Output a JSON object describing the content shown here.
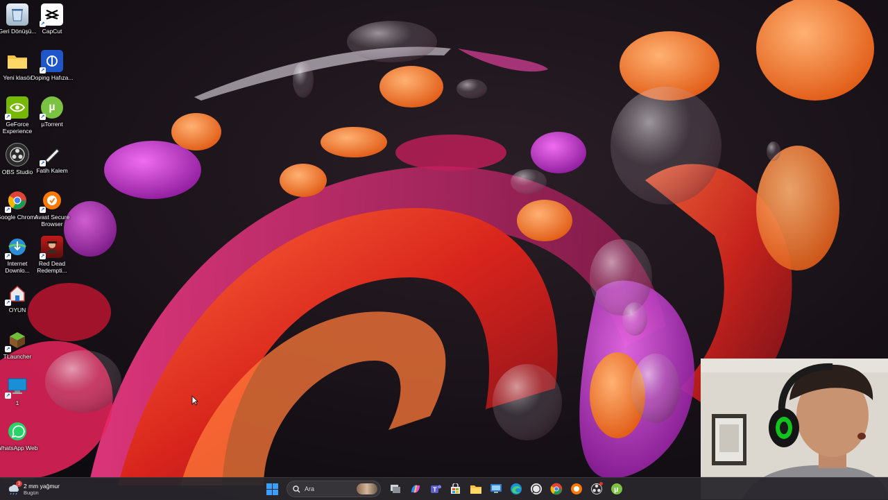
{
  "desktop_icons": [
    {
      "label": "Geri Dönüşü...",
      "icon": "recycle-bin-icon"
    },
    {
      "label": "CapCut",
      "icon": "capcut-icon"
    },
    {
      "label": "Yeni klasör",
      "icon": "folder-icon"
    },
    {
      "label": "Doping Hafıza...",
      "icon": "doping-hafiza-icon"
    },
    {
      "label": "GeForce Experience",
      "icon": "geforce-icon"
    },
    {
      "label": "µTorrent",
      "icon": "utorrent-icon"
    },
    {
      "label": "OBS Studio",
      "icon": "obs-icon"
    },
    {
      "label": "Fatih Kalem",
      "icon": "pen-icon"
    },
    {
      "label": "Google Chrome",
      "icon": "chrome-icon"
    },
    {
      "label": "Avast Secure Browser",
      "icon": "avast-browser-icon"
    },
    {
      "label": "Internet Downlo...",
      "icon": "internet-download-manager-icon"
    },
    {
      "label": "Red Dead Redempti...",
      "icon": "red-dead-icon"
    },
    {
      "label": "OYUN",
      "icon": "game-folder-icon"
    },
    {
      "label": "TLauncher",
      "icon": "tlauncher-icon"
    },
    {
      "label": "1",
      "icon": "monitor-icon"
    },
    {
      "label": "WhatsApp Web",
      "icon": "whatsapp-icon"
    }
  ],
  "taskbar": {
    "weather": {
      "main": "2 mm yağmur",
      "sub": "Bugün",
      "badge": "3"
    },
    "search_placeholder": "Ara",
    "apps": [
      "start-icon",
      "task-view-icon",
      "copilot-icon",
      "teams-icon",
      "store-icon",
      "file-explorer-icon",
      "remote-desktop-icon",
      "edge-icon",
      "whatsapp-icon",
      "chrome-icon",
      "avast-icon",
      "obs-icon",
      "utorrent-icon"
    ]
  },
  "colors": {
    "taskbar": "#28262c",
    "accent": "#0078d4"
  }
}
